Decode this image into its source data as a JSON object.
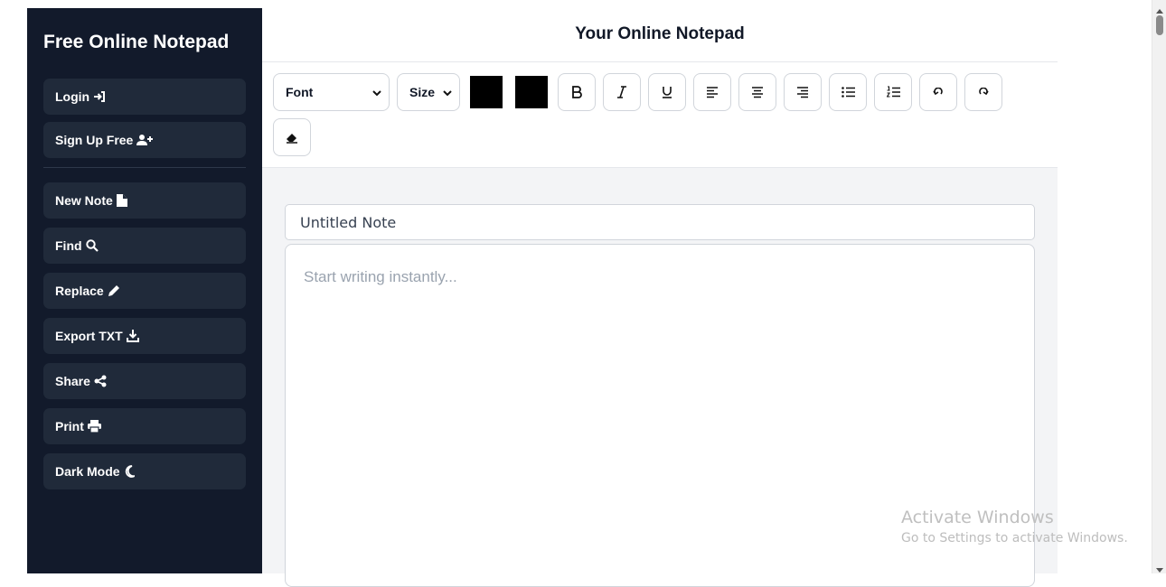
{
  "sidebar": {
    "title": "Free Online Notepad",
    "auth_buttons": [
      {
        "label": "Login",
        "icon": "login-icon"
      },
      {
        "label": "Sign Up Free",
        "icon": "user-plus-icon"
      }
    ],
    "action_buttons": [
      {
        "label": "New Note",
        "icon": "file-icon"
      },
      {
        "label": "Find",
        "icon": "search-icon"
      },
      {
        "label": "Replace",
        "icon": "pencil-icon"
      },
      {
        "label": "Export TXT",
        "icon": "download-icon"
      },
      {
        "label": "Share",
        "icon": "share-icon"
      },
      {
        "label": "Print",
        "icon": "print-icon"
      },
      {
        "label": "Dark Mode",
        "icon": "moon-icon"
      }
    ]
  },
  "header": {
    "title": "Your Online Notepad"
  },
  "toolbar": {
    "font_select": {
      "value": "Font"
    },
    "size_select": {
      "value": "Size"
    },
    "text_color": "#000000",
    "highlight_color": "#000000",
    "buttons": [
      "bold-icon",
      "italic-icon",
      "underline-icon",
      "align-left-icon",
      "align-center-icon",
      "align-right-icon",
      "bullet-list-icon",
      "numbered-list-icon",
      "undo-icon",
      "redo-icon",
      "eraser-icon"
    ]
  },
  "note": {
    "title_value": "Untitled Note",
    "body_placeholder": "Start writing instantly..."
  },
  "watermark": {
    "title": "Activate Windows",
    "subtitle": "Go to Settings to activate Windows."
  },
  "colors": {
    "sidebar_bg": "#121a2b",
    "sidebar_button_bg": "#202a3a",
    "main_bg": "#f3f4f6"
  }
}
